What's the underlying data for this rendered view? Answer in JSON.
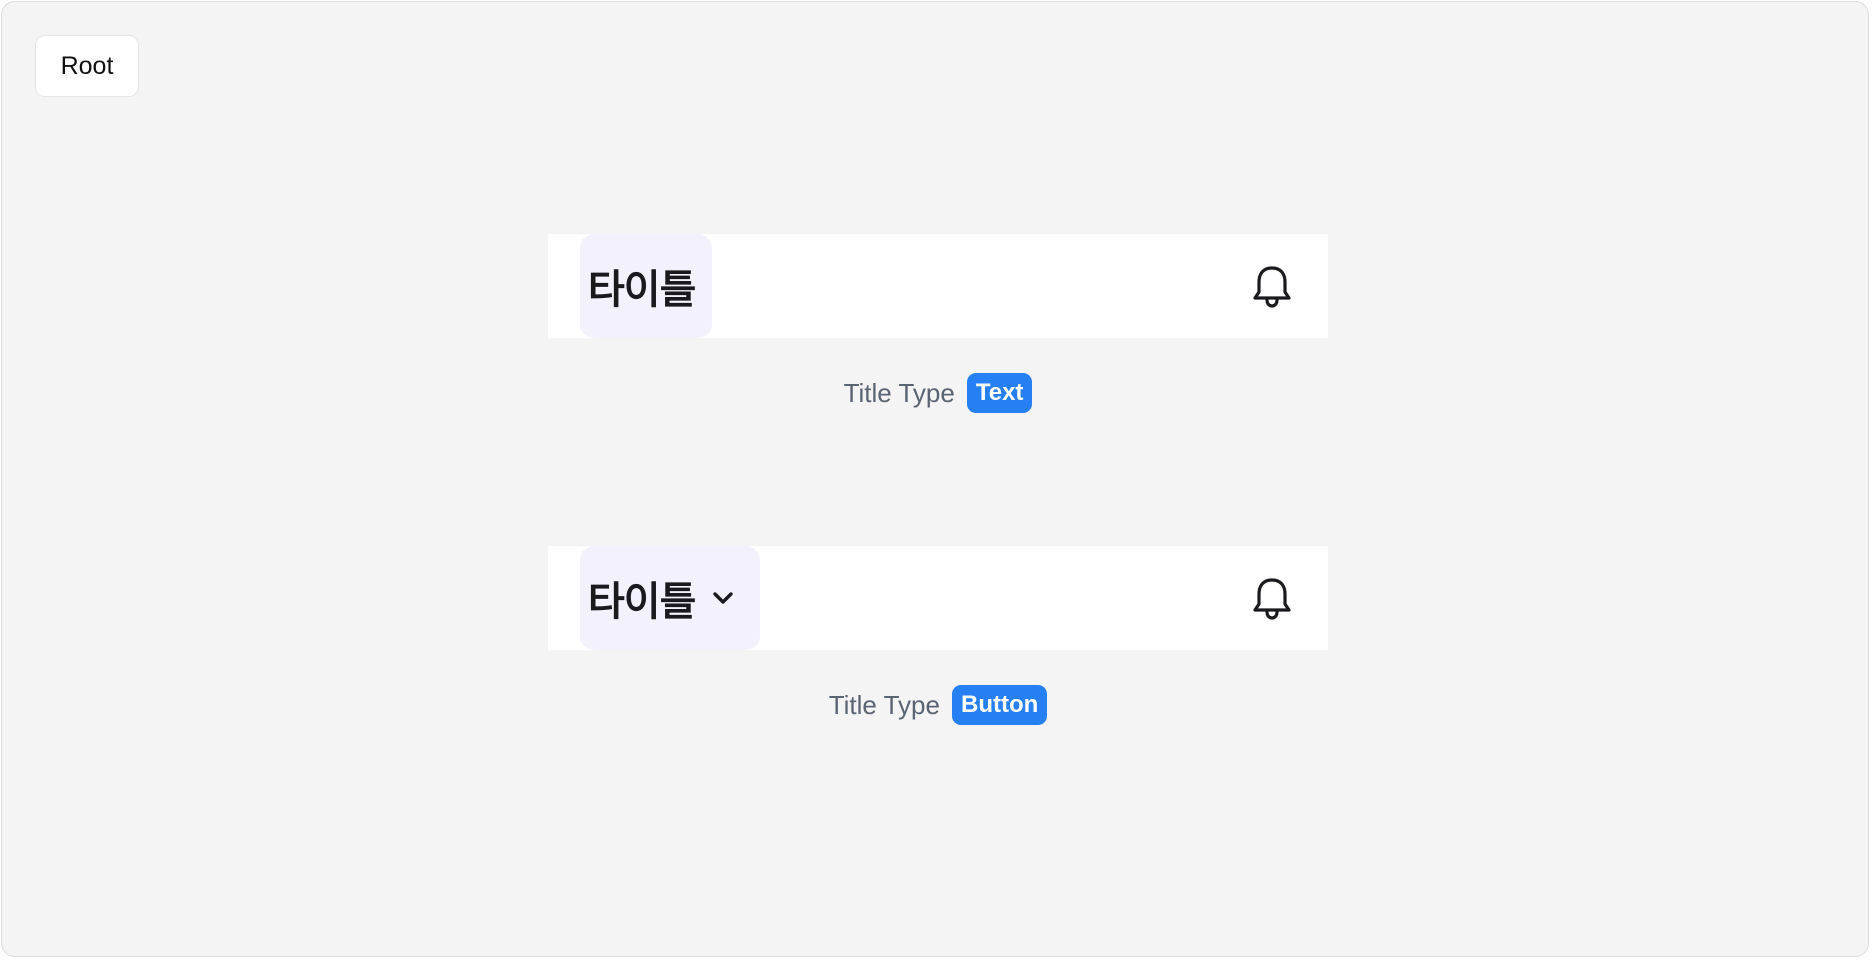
{
  "root_label": "Root",
  "examples": [
    {
      "title": "타이틀",
      "has_chevron": false,
      "caption_label": "Title Type",
      "caption_value": "Text"
    },
    {
      "title": "타이틀",
      "has_chevron": true,
      "caption_label": "Title Type",
      "caption_value": "Button"
    }
  ],
  "icons": {
    "notification": "bell-icon",
    "dropdown": "chevron-down-icon"
  },
  "colors": {
    "canvas_bg": "#f4f4f5",
    "title_slot_bg": "#f3f1fb",
    "badge_bg": "#2680f4",
    "caption_text": "#5b6472",
    "title_text": "#1a1a1e"
  }
}
